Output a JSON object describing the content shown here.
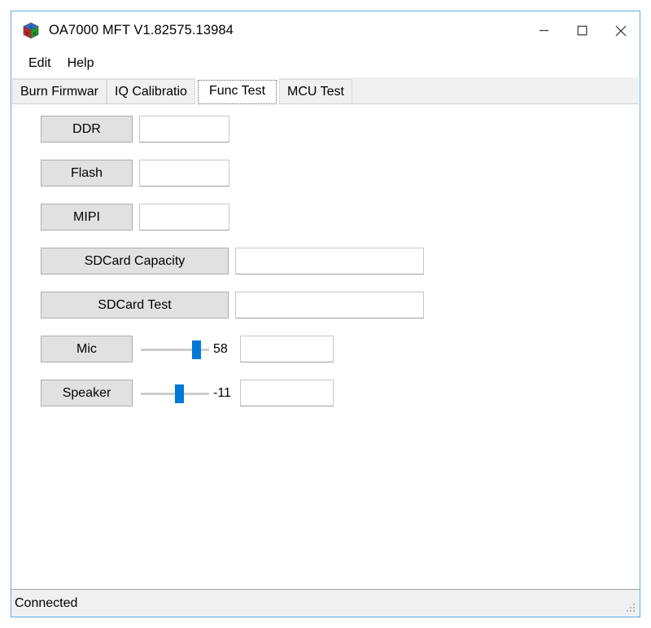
{
  "window": {
    "title": "OA7000 MFT V1.82575.13984",
    "icon": "rgb-cube-icon",
    "border_color": "#60a9de",
    "controls": {
      "minimize": "minimize-icon",
      "maximize": "maximize-icon",
      "close": "close-icon"
    }
  },
  "menubar": {
    "items": [
      {
        "label": "Edit"
      },
      {
        "label": "Help"
      }
    ]
  },
  "tabs": {
    "selected_index": 2,
    "items": [
      {
        "label": "Burn Firmwar"
      },
      {
        "label": "IQ Calibratio"
      },
      {
        "label": "Func Test"
      },
      {
        "label": "MCU Test"
      }
    ]
  },
  "func_test": {
    "rows": [
      {
        "button": "DDR",
        "value": "",
        "placeholder": ""
      },
      {
        "button": "Flash",
        "value": "",
        "placeholder": ""
      },
      {
        "button": "MIPI",
        "value": "",
        "placeholder": ""
      },
      {
        "button": "SDCard Capacity",
        "value": "",
        "placeholder": ""
      },
      {
        "button": "SDCard Test",
        "value": "",
        "placeholder": ""
      },
      {
        "button": "Mic",
        "slider_value": "58",
        "value": "",
        "placeholder": ""
      },
      {
        "button": "Speaker",
        "slider_value": "-11",
        "value": "",
        "placeholder": ""
      }
    ],
    "accent_color": "#0078d7"
  },
  "statusbar": {
    "text": "Connected",
    "grip": "resize-grip-icon"
  }
}
